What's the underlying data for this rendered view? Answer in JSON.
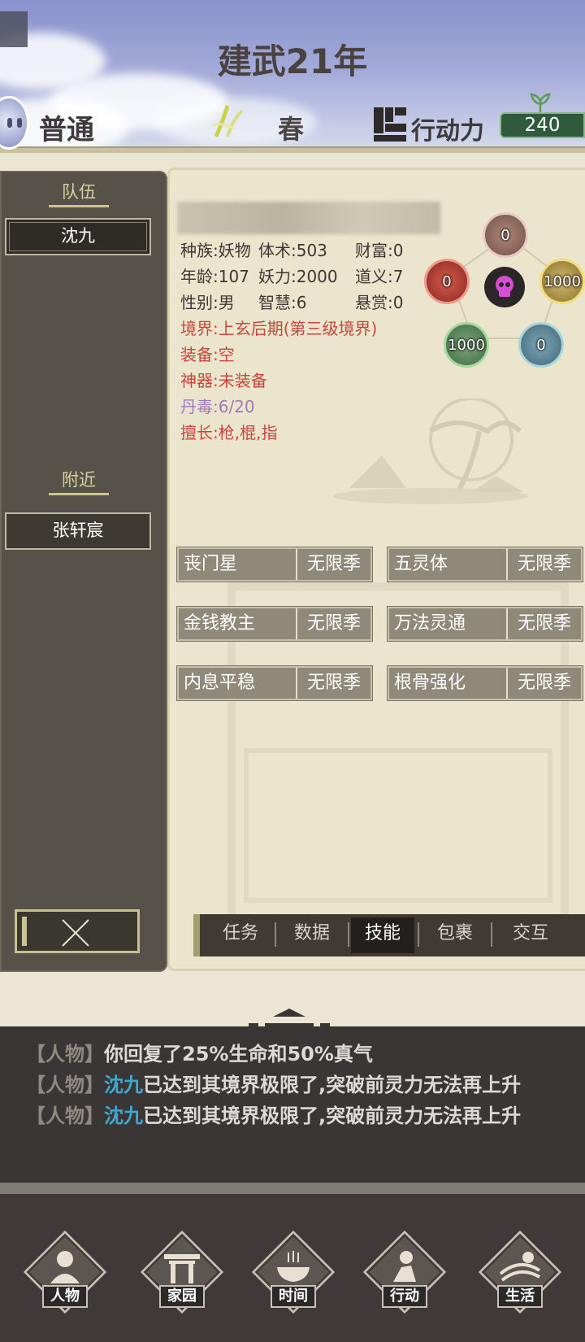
{
  "header": {
    "year": "建武21年",
    "mode": "普通",
    "season": "春",
    "action_points_label": "行动力",
    "action_points_value": "240"
  },
  "left_panel": {
    "team_title": "队伍",
    "team_members": [
      "沈九"
    ],
    "nearby_title": "附近",
    "nearby_people": [
      "张轩宸"
    ]
  },
  "character": {
    "race": "种族:妖物",
    "body": "体术:503",
    "wealth": "财富:0",
    "age": "年龄:107",
    "demon_power": "妖力:2000",
    "righteousness": "道义:7",
    "gender": "性别:男",
    "wisdom": "智慧:6",
    "bounty": "悬赏:0",
    "realm": "境界:上玄后期(第三级境界)",
    "equipment": "装备:空",
    "artifact": "神器:未装备",
    "pill_poison": "丹毒:6/20",
    "specialty": "擅长:枪,棍,指"
  },
  "elements": {
    "top": "0",
    "right": "1000",
    "bottom_right": "0",
    "bottom_left": "1000",
    "left": "0"
  },
  "skills": [
    {
      "name": "丧门星",
      "duration": "无限季"
    },
    {
      "name": "五灵体",
      "duration": "无限季"
    },
    {
      "name": "金钱教主",
      "duration": "无限季"
    },
    {
      "name": "万法灵通",
      "duration": "无限季"
    },
    {
      "name": "内息平稳",
      "duration": "无限季"
    },
    {
      "name": "根骨强化",
      "duration": "无限季"
    }
  ],
  "tabs": [
    "任务",
    "数据",
    "技能",
    "包裹",
    "交互"
  ],
  "active_tab": "技能",
  "log": [
    {
      "tag": "【人物】",
      "who": "",
      "text": "你回复了25%生命和50%真气"
    },
    {
      "tag": "【人物】",
      "who": "沈九",
      "text": "已达到其境界极限了,突破前灵力无法再上升"
    },
    {
      "tag": "【人物】",
      "who": "沈九",
      "text": "已达到其境界极限了,突破前灵力无法再上升"
    }
  ],
  "nav": [
    "人物",
    "家园",
    "时间",
    "行动",
    "生活"
  ]
}
